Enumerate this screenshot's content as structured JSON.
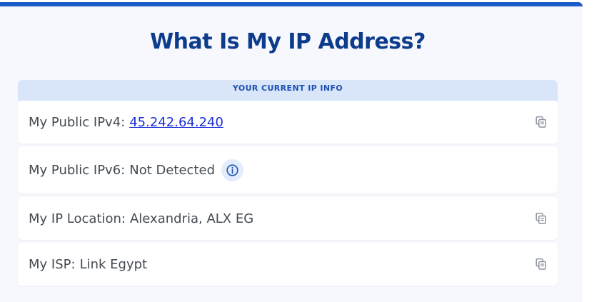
{
  "page": {
    "title": "What Is My IP Address?"
  },
  "ip_info": {
    "header": "YOUR CURRENT IP INFO",
    "rows": [
      {
        "label": "My Public IPv4:",
        "value": "45.242.64.240"
      },
      {
        "label": "My Public IPv6:",
        "value": "Not Detected"
      },
      {
        "label": "My IP Location:",
        "value": "Alexandria, ALX EG"
      },
      {
        "label": "My ISP:",
        "value": "Link Egypt"
      }
    ]
  },
  "colors": {
    "accent": "#1a5cc8",
    "title": "#0d3c8c",
    "header_bg": "#d9e6fa",
    "link": "#1a2fd6",
    "text": "#444a52"
  },
  "icons": {
    "copy": "copy-icon",
    "info": "info-icon"
  }
}
